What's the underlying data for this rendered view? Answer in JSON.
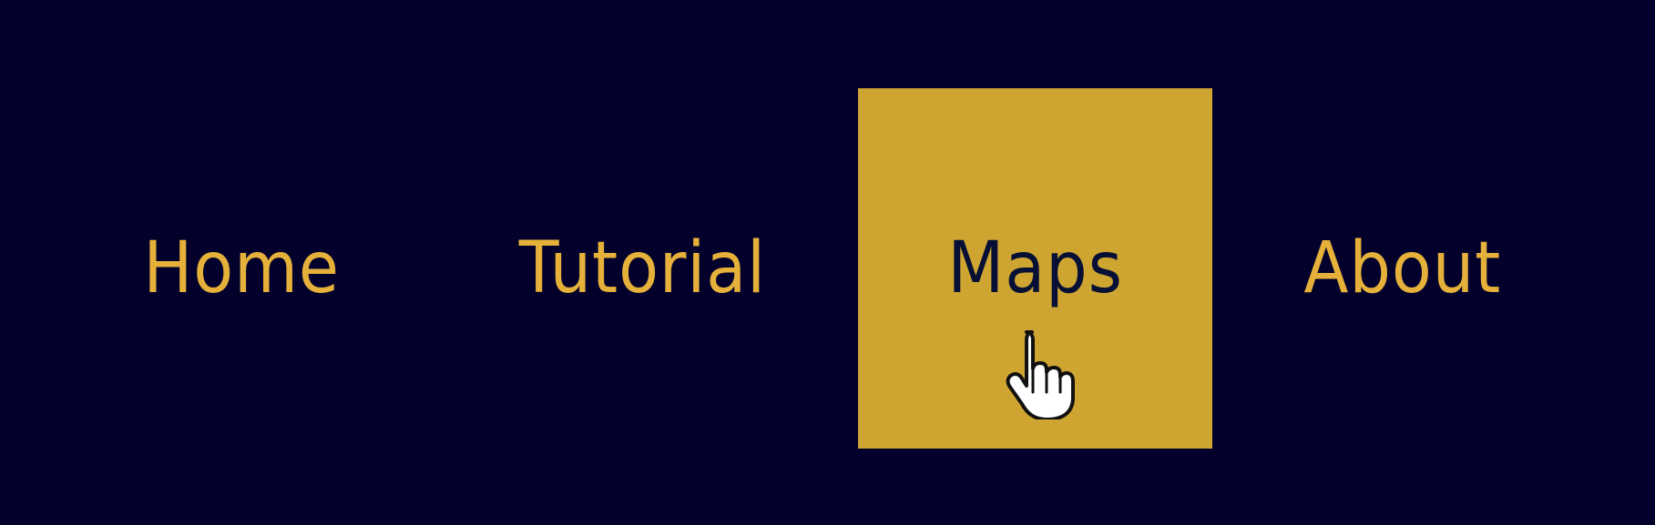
{
  "nav": {
    "items": [
      {
        "label": "Home",
        "state": "normal"
      },
      {
        "label": "Tutorial",
        "state": "normal"
      },
      {
        "label": "Maps",
        "state": "hover"
      },
      {
        "label": "About",
        "state": "normal"
      }
    ]
  },
  "colors": {
    "background": "#03002b",
    "text": "#e6b13a",
    "hover_background": "#cfa532",
    "hover_text": "#061035"
  },
  "cursor": {
    "type": "hand-pointer-icon"
  }
}
